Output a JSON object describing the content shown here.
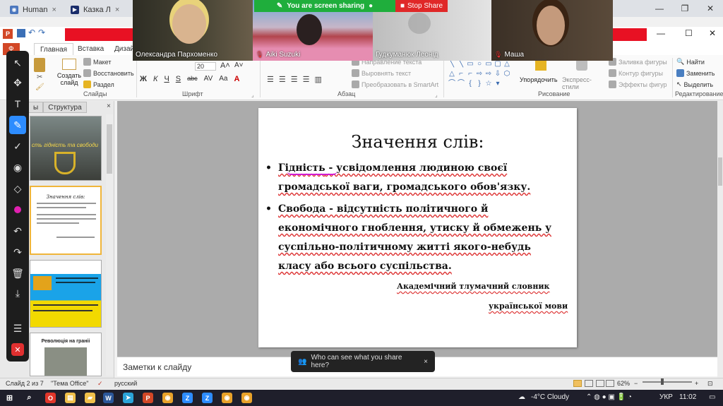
{
  "browser": {
    "tabs": [
      {
        "label": "Human",
        "close": "×"
      },
      {
        "label": "Казка Л",
        "close": "×"
      }
    ],
    "window_controls": {
      "minimize": "—",
      "restore": "❐",
      "close": "✕"
    }
  },
  "zoom": {
    "share_banner": "You are screen sharing",
    "stop_share": "Stop Share",
    "participants": [
      {
        "name": "Олександра Пархоменко",
        "muted": false
      },
      {
        "name": "Aiki Suzuki",
        "muted": true
      },
      {
        "name": "Гудкуманюк Леонід",
        "muted": false
      },
      {
        "name": "Маша",
        "muted": true
      }
    ]
  },
  "ppt": {
    "title_controls": {
      "minimize": "—",
      "maximize": "☐",
      "close": "✕"
    },
    "tabs": [
      {
        "label": "Ф",
        "kind": "file"
      },
      {
        "label": "Главная",
        "kind": "active"
      },
      {
        "label": "Вставка",
        "kind": "normal"
      },
      {
        "label": "Дизай",
        "kind": "normal"
      }
    ],
    "ribbon": {
      "slides_group": {
        "create_slide": "Создать слайд",
        "layout": "Макет",
        "restore": "Восстановить",
        "section": "Раздел",
        "label": "Слайды"
      },
      "font_group": {
        "size": "20",
        "bold": "Ж",
        "italic": "К",
        "underline": "Ч",
        "strike": "S",
        "abc": "abc",
        "label": "Шрифт"
      },
      "para_group": {
        "text_direction": "Направление текста",
        "align_text": "Выровнять текст",
        "smartart": "Преобразовать в SmartArt",
        "label": "Абзац"
      },
      "drawing_group": {
        "arrange": "Упорядочить",
        "quick_styles": "Экспресс-стили",
        "fill": "Заливка фигуры",
        "outline": "Контур фигуры",
        "effects": "Эффекты фигур",
        "label": "Рисование"
      },
      "editing_group": {
        "find": "Найти",
        "replace": "Заменить",
        "select": "Выделить",
        "label": "Редактирование"
      }
    },
    "panel": {
      "tab_slides": "ы",
      "tab_outline": "Структура",
      "close": "×",
      "thumbs": [
        {
          "text": "сть гідність та свободи"
        },
        {
          "text": "Значення слів:"
        },
        {
          "text": ""
        },
        {
          "text": "Революція на граніі"
        }
      ]
    },
    "slide": {
      "title": "Значення слів:",
      "bullet1_term": "Гідність",
      "bullet1_rest": " - усвідомлення людиною своєї громадської ваги, громадського обов'язку.",
      "bullet2": "Свобода - відсутність політичного й економічного гноблення, утиску й обмежень у суспільно-політичному житті якого-небудь класу або всього суспільства.",
      "source_line1": "Академічний тлумачний словник",
      "source_line2": "української мови"
    },
    "notes_placeholder": "Заметки к слайду",
    "toast": "Who can see what you share here?",
    "toast_close": "×",
    "status": {
      "slide_counter": "Слайд 2 из 7",
      "theme": "\"Тема Office\"",
      "language": "русский",
      "zoom": "62%",
      "zoom_minus": "−",
      "zoom_plus": "+"
    }
  },
  "taskbar": {
    "weather": "-4°C  Cloudy",
    "lang": "УКР",
    "time": "11:02"
  }
}
